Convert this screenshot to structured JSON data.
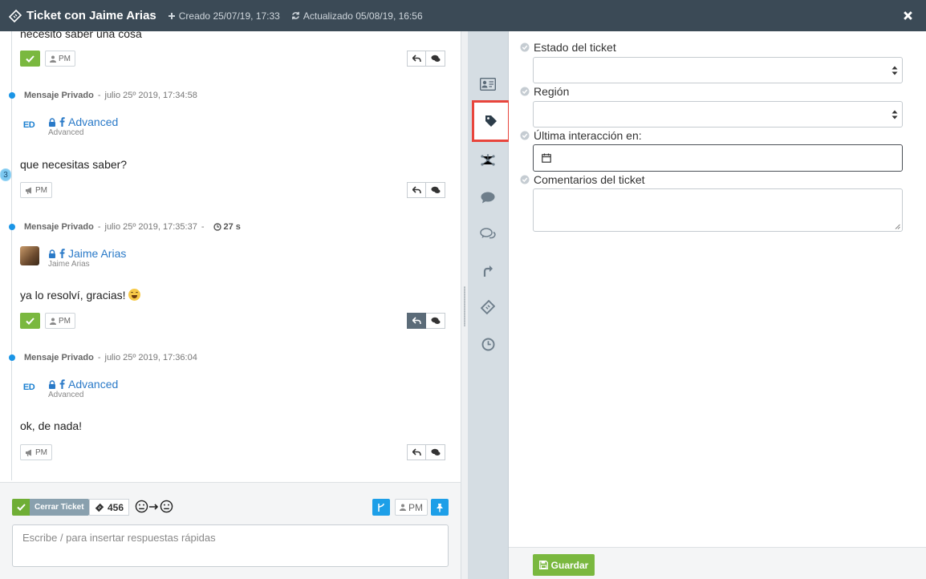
{
  "header": {
    "title": "Ticket con Jaime Arias",
    "created": "Creado 25/07/19, 17:33",
    "updated": "Actualizado 05/08/19, 16:56",
    "background": "#3b4a56"
  },
  "conversation": {
    "top_partial_text": "necesito saber una cosa",
    "pm_label": "PM",
    "count_badge": "3",
    "messages": [
      {
        "type": "Mensaje Privado",
        "date": "julio 25º 2019, 17:34:58",
        "author": "Advanced",
        "author_sub": "Advanced",
        "avatar_initials": "ED",
        "text": "que necesitas saber?"
      },
      {
        "type": "Mensaje Privado",
        "date": "julio 25º 2019, 17:35:37",
        "duration": "27 s",
        "author": "Jaime Arias",
        "author_sub": "Jaime Arias",
        "text": "ya lo resolví, gracias!"
      },
      {
        "type": "Mensaje Privado",
        "date": "julio 25º 2019, 17:36:04",
        "author": "Advanced",
        "author_sub": "Advanced",
        "avatar_initials": "ED",
        "text": "ok, de nada!"
      }
    ]
  },
  "composer": {
    "close_ticket_label": "Cerrar Ticket",
    "ticket_number": "456",
    "pm_label": "PM",
    "reply_placeholder": "Escribe / para insertar respuestas rápidas"
  },
  "rail": {
    "items": [
      "contact-card-icon",
      "tag-icon",
      "network-icon",
      "comment-icon",
      "comments-icon",
      "share-icon",
      "ticket-icon",
      "clock-icon"
    ],
    "active": "tag-icon",
    "highlight_color": "#e8453c"
  },
  "form": {
    "fields": {
      "estado": {
        "label": "Estado del ticket",
        "value": ""
      },
      "region": {
        "label": "Región",
        "value": ""
      },
      "ultima": {
        "label": "Última interacción en:",
        "value": ""
      },
      "comentarios": {
        "label": "Comentarios del ticket",
        "value": ""
      }
    },
    "save_label": "Guardar"
  },
  "colors": {
    "green": "#7ab83f",
    "blue": "#1d9fe8",
    "link": "#2a7ac8"
  }
}
